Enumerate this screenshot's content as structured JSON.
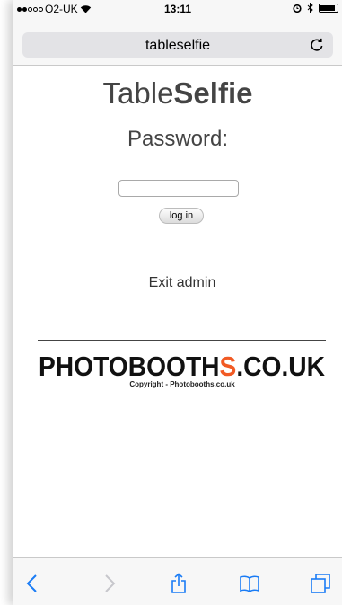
{
  "status": {
    "carrier": "O2-UK",
    "time": "13:11",
    "signal_bars": 2,
    "signal_max": 5,
    "battery_level": 0.9
  },
  "browser": {
    "address": "tableselfie"
  },
  "page": {
    "title_light": "Table",
    "title_bold": "Selfie",
    "password_label": "Password:",
    "password_value": "",
    "login_button": "log in",
    "exit_link": "Exit admin",
    "logo_text_left": "PHOTOBOOTH",
    "logo_text_s": "S",
    "logo_text_right": ".CO.UK",
    "copyright": "Copyright - Photobooths.co.uk"
  },
  "colors": {
    "accent": "#1a7cf5",
    "logo_s": "#f15a24",
    "text": "#444444"
  },
  "icons": {
    "back": "chevron-left-icon",
    "forward": "chevron-right-icon",
    "share": "share-icon",
    "bookmarks": "book-icon",
    "tabs": "tabs-icon",
    "reload": "reload-icon"
  }
}
